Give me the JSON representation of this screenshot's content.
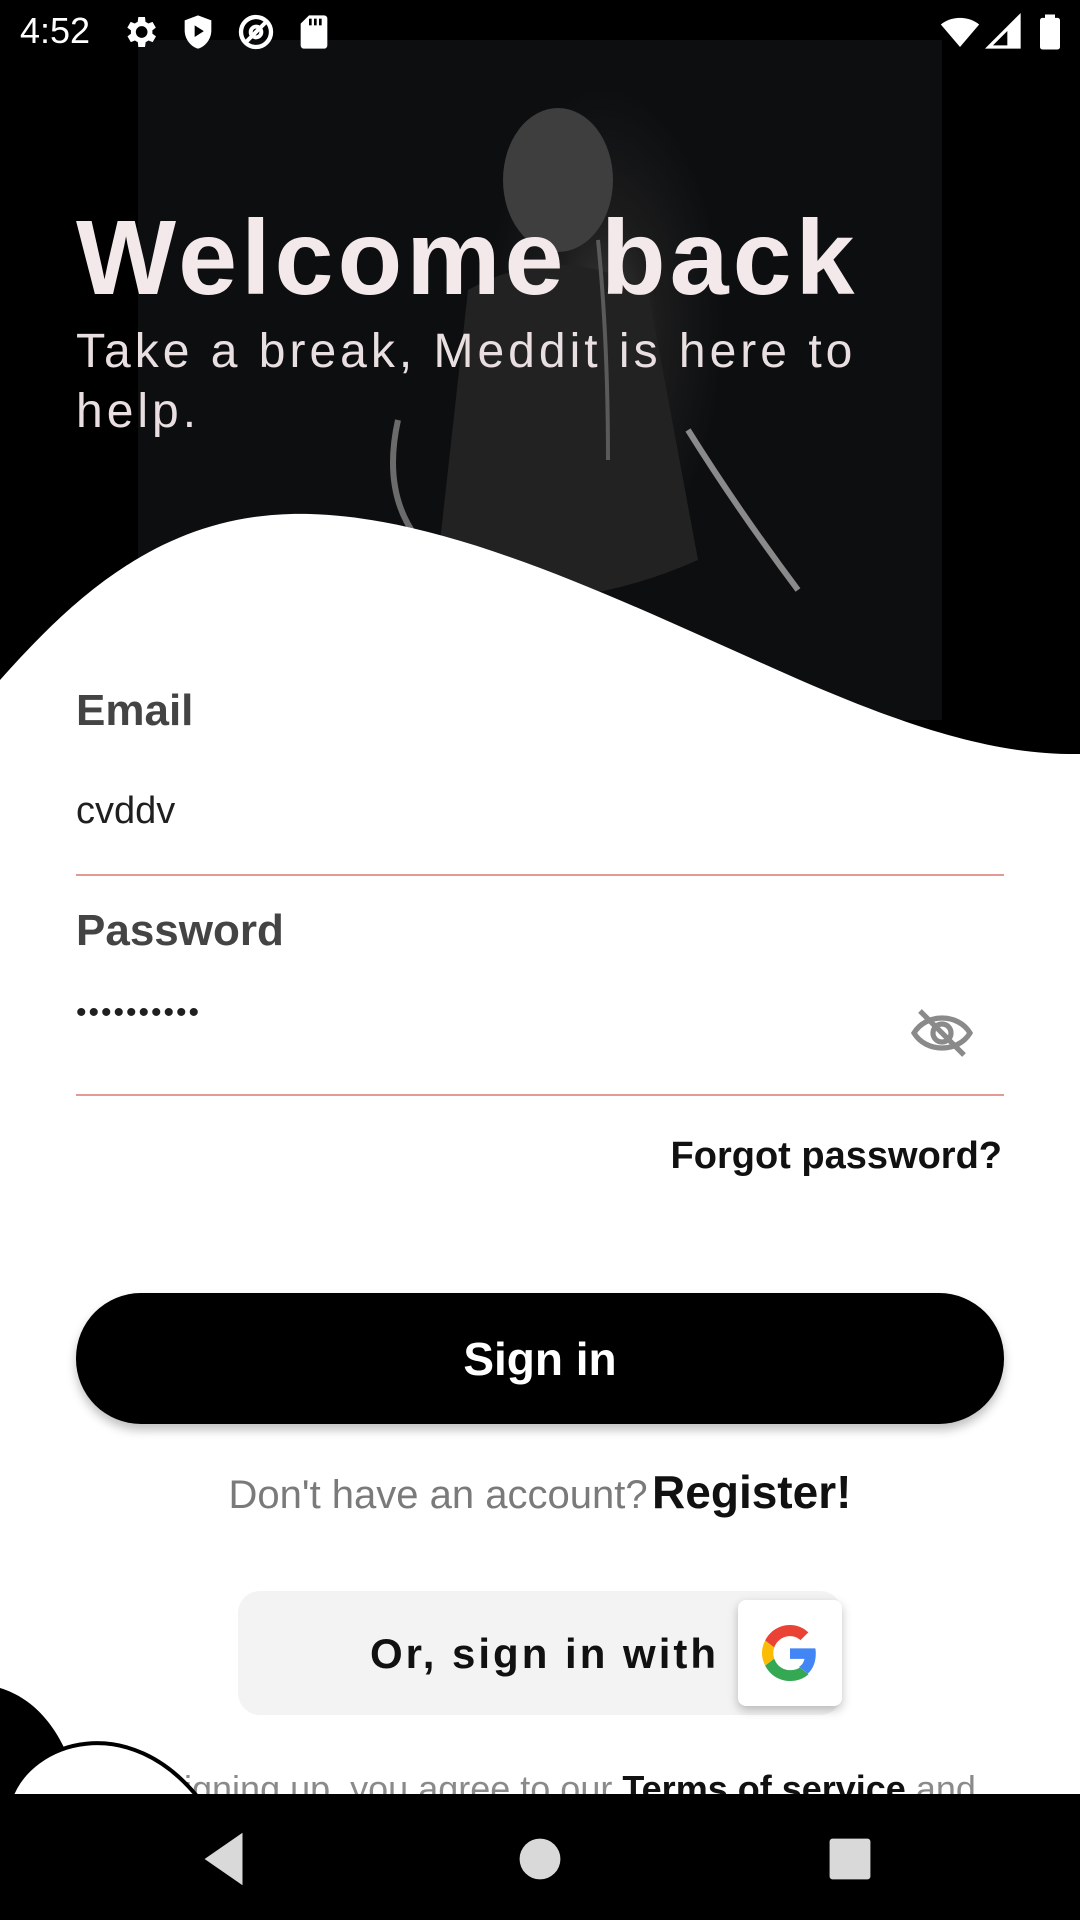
{
  "status_bar": {
    "time": "4:52",
    "left_icons": [
      "settings-icon",
      "shield-play-icon",
      "at-sign-icon",
      "sd-card-icon"
    ],
    "right_icons": [
      "wifi-icon",
      "signal-icon",
      "battery-icon"
    ]
  },
  "hero": {
    "title": "Welcome back",
    "subtitle": "Take a break, Meddit is here to help."
  },
  "form": {
    "email_label": "Email",
    "email_value": "cvddv",
    "password_label": "Password",
    "password_value": "••••••••••",
    "password_toggle_icon": "eye-off-icon",
    "forgot_label": "Forgot password?",
    "signin_label": "Sign in"
  },
  "register": {
    "prompt": "Don't have an account?",
    "link": "Register!"
  },
  "social": {
    "label": "Or, sign in with",
    "provider_icon": "google-icon"
  },
  "terms": {
    "prefix": "By signing up, you agree to our",
    "link": "Terms of service",
    "suffix": "and"
  },
  "nav_bar": {
    "buttons": [
      "back-icon",
      "home-icon",
      "recents-icon"
    ]
  },
  "colors": {
    "accent_line": "#e39a96",
    "primary_button": "#000000",
    "title_text": "#f3e9ea"
  }
}
